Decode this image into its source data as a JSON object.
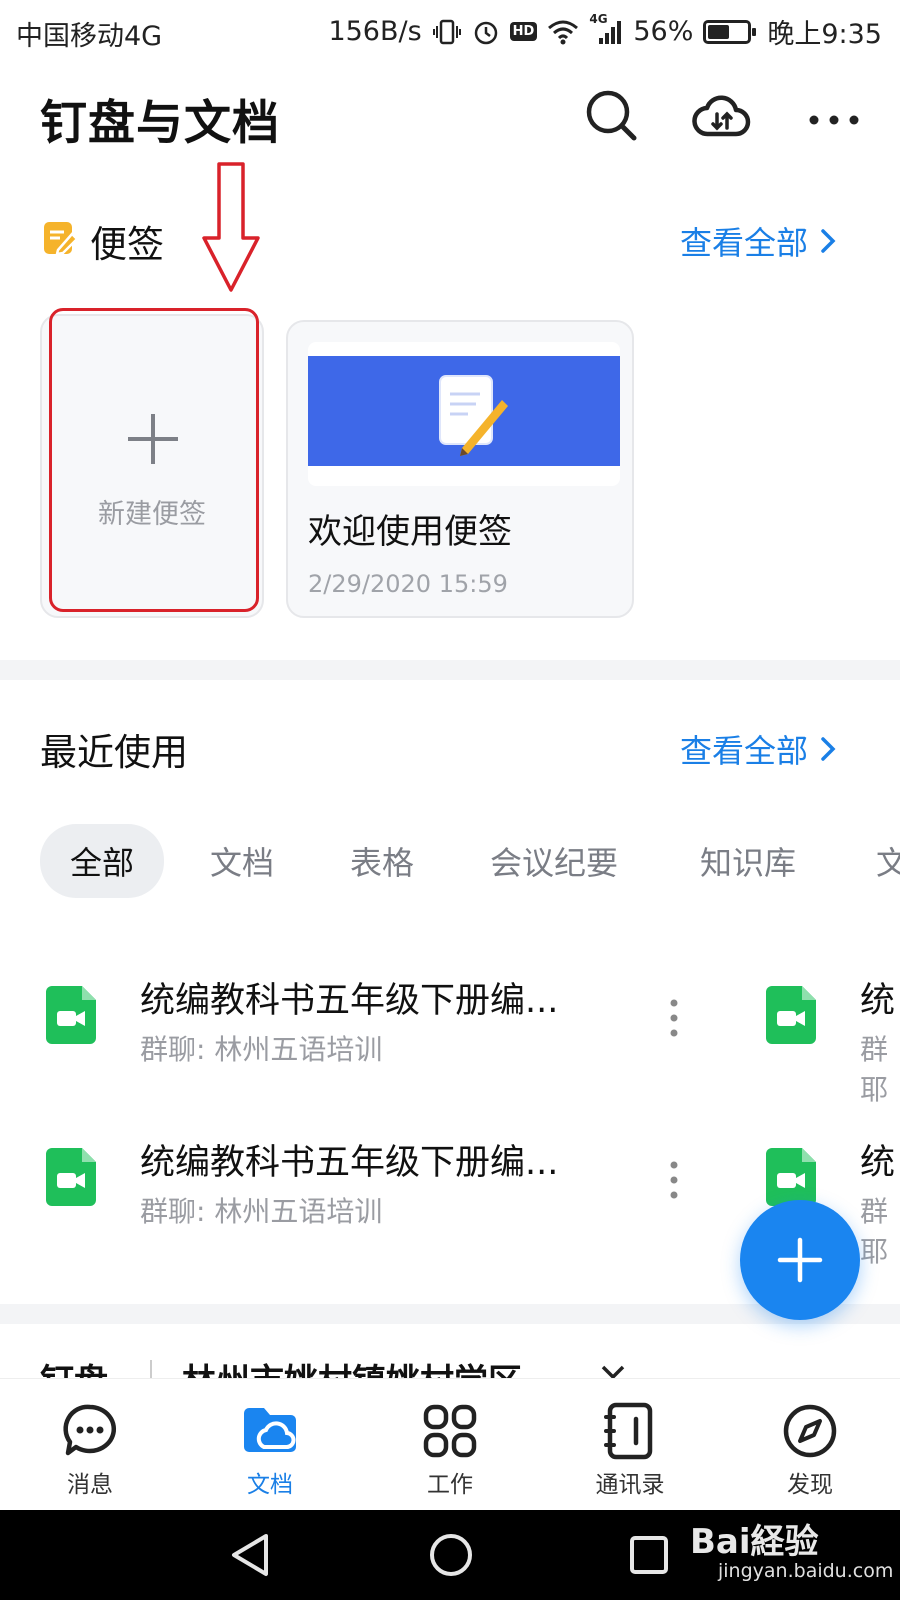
{
  "status": {
    "carrier": "中国移动4G",
    "speed": "156B/s",
    "network_tag": "4G",
    "hd": "HD",
    "battery": "56%",
    "battery_level": 0.56,
    "time": "晚上9:35"
  },
  "header": {
    "title": "钉盘与文档",
    "icons": [
      "search-icon",
      "cloud-transfer-icon",
      "more-icon"
    ]
  },
  "notes": {
    "label": "便签",
    "see_all": "查看全部",
    "new_note_label": "新建便签",
    "card": {
      "title": "欢迎使用便签",
      "date": "2/29/2020 15:59"
    }
  },
  "recent": {
    "label": "最近使用",
    "see_all": "查看全部",
    "tabs": [
      "全部",
      "文档",
      "表格",
      "会议纪要",
      "知识库",
      "文"
    ],
    "items": [
      {
        "title": "统编教科书五年级下册编...",
        "subtitle": "群聊: 林州五语培训"
      },
      {
        "title": "统编教科书五年级下册编...",
        "subtitle": "群聊: 林州五语培训"
      }
    ],
    "peek_items": [
      {
        "title": "统",
        "subtitle": "群耶"
      },
      {
        "title": "统",
        "subtitle": "群耶"
      }
    ]
  },
  "drive": {
    "label": "钉盘",
    "org": "林州市姚村镇姚村学区"
  },
  "nav": {
    "items": [
      {
        "label": "消息",
        "icon": "message-icon"
      },
      {
        "label": "文档",
        "icon": "folder-icon"
      },
      {
        "label": "工作",
        "icon": "grid-icon"
      },
      {
        "label": "通讯录",
        "icon": "contacts-icon"
      },
      {
        "label": "发现",
        "icon": "compass-icon"
      }
    ],
    "active": "文档"
  },
  "watermark": {
    "text": "Bai経验",
    "url_text": "jingyan.baidu.com"
  },
  "colors": {
    "accent": "#1a85f0",
    "link": "#1a7fe6",
    "doc_green": "#1fbf5a",
    "note_yellow": "#f5b32b",
    "highlight_red": "#d9222a"
  }
}
